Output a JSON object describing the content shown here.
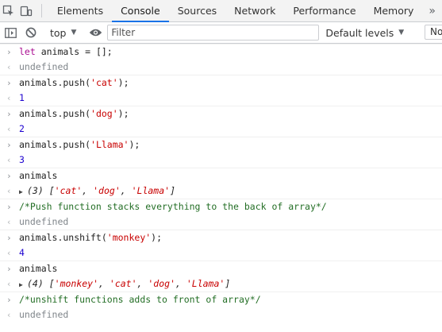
{
  "tabs": [
    "Elements",
    "Console",
    "Sources",
    "Network",
    "Performance",
    "Memory"
  ],
  "tabs_more": "»",
  "toolbar": {
    "context": "top",
    "filter_placeholder": "Filter",
    "levels": "Default levels",
    "no_group_label": "No"
  },
  "entries": [
    {
      "kind": "in",
      "text": "let animals = [];"
    },
    {
      "kind": "out",
      "text": "undefined"
    },
    {
      "kind": "in",
      "text": "animals.push('cat');"
    },
    {
      "kind": "out",
      "text": "1"
    },
    {
      "kind": "in",
      "text": "animals.push('dog');"
    },
    {
      "kind": "out",
      "text": "2"
    },
    {
      "kind": "in",
      "text": "animals.push('Llama');"
    },
    {
      "kind": "out",
      "text": "3"
    },
    {
      "kind": "in",
      "text": "animals"
    },
    {
      "kind": "obj",
      "count": "(3)",
      "items": [
        "'cat'",
        "'dog'",
        "'Llama'"
      ]
    },
    {
      "kind": "comment",
      "text": "/*Push function stacks everything to the back of array*/"
    },
    {
      "kind": "out",
      "text": "undefined"
    },
    {
      "kind": "in",
      "text": "animals.unshift('monkey');"
    },
    {
      "kind": "out",
      "text": "4"
    },
    {
      "kind": "in",
      "text": "animals"
    },
    {
      "kind": "obj",
      "count": "(4)",
      "items": [
        "'monkey'",
        "'cat'",
        "'dog'",
        "'Llama'"
      ]
    },
    {
      "kind": "comment",
      "text": "/*unshift functions adds to front of array*/"
    },
    {
      "kind": "out",
      "text": "undefined"
    }
  ]
}
